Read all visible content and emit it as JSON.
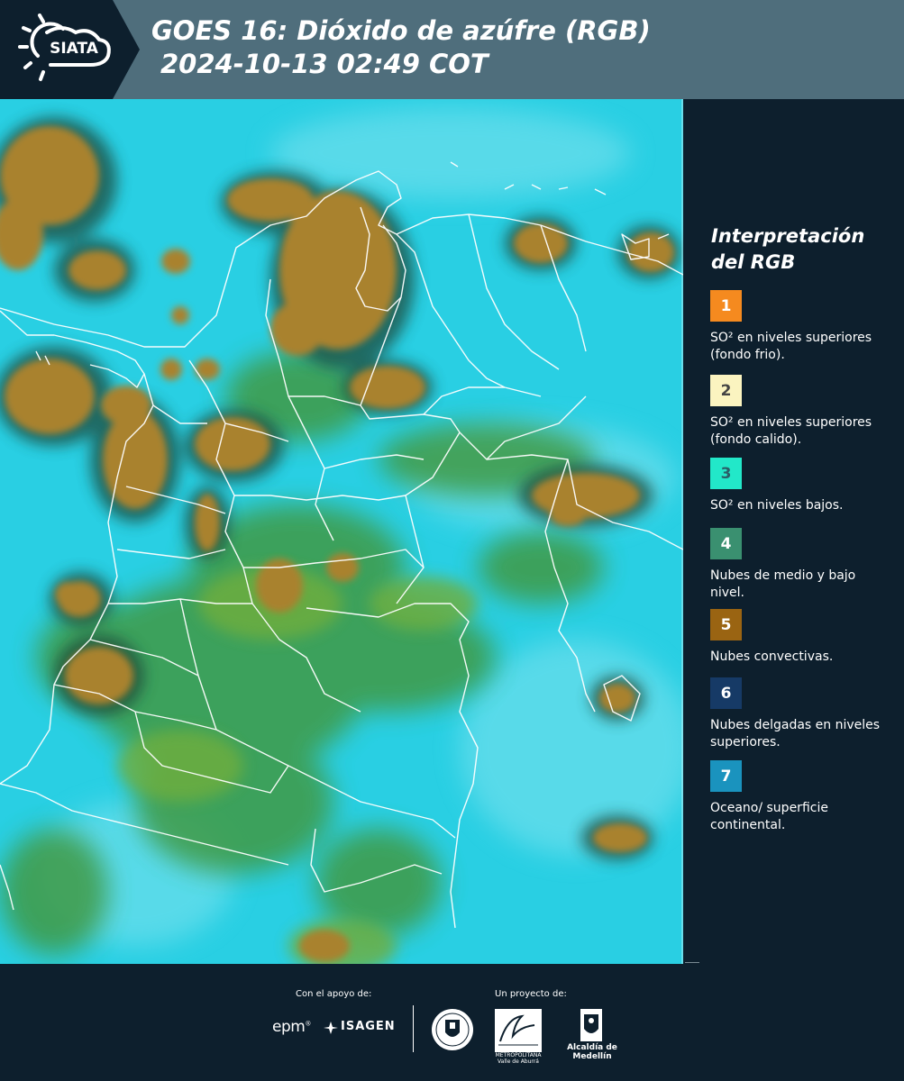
{
  "header": {
    "title_line1": "GOES 16: Dióxido de azúfre (RGB)",
    "title_line2": "2024-10-13 02:49 COT",
    "logo_text": "SIATA"
  },
  "map": {
    "base_color": "#29cfe3",
    "convective_color": "#a07c2e",
    "mid_low_color": "#3e9a4e",
    "border_color": "#ffffff"
  },
  "legend": {
    "title_line1": "Interpretación",
    "title_line2": "del RGB",
    "items": [
      {
        "number": "1",
        "color": "#f58a1f",
        "text_color": "#ffffff",
        "label": "SO² en niveles superiores (fondo frio)."
      },
      {
        "number": "2",
        "color": "#fbf4c0",
        "text_color": "#444444",
        "label": "SO² en niveles superiores (fondo calido)."
      },
      {
        "number": "3",
        "color": "#22e8c9",
        "text_color": "#2a5f68",
        "label": "SO² en niveles bajos."
      },
      {
        "number": "4",
        "color": "#3a9070",
        "text_color": "#ffffff",
        "label": "Nubes de medio y bajo nivel."
      },
      {
        "number": "5",
        "color": "#9a6412",
        "text_color": "#ffffff",
        "label": "Nubes convectivas."
      },
      {
        "number": "6",
        "color": "#163a66",
        "text_color": "#ffffff",
        "label": "Nubes delgadas en niveles superiores."
      },
      {
        "number": "7",
        "color": "#1a93be",
        "text_color": "#ffffff",
        "label": "Oceano/ superficie continental."
      }
    ]
  },
  "footer": {
    "support_label": "Con el apoyo de:",
    "project_label": "Un proyecto de:",
    "epm": "epm",
    "isagen": "ISAGEN",
    "metro_text": "METROPOLITANA Valle de Aburrá",
    "alcaldia": "Alcaldía de Medellín"
  }
}
